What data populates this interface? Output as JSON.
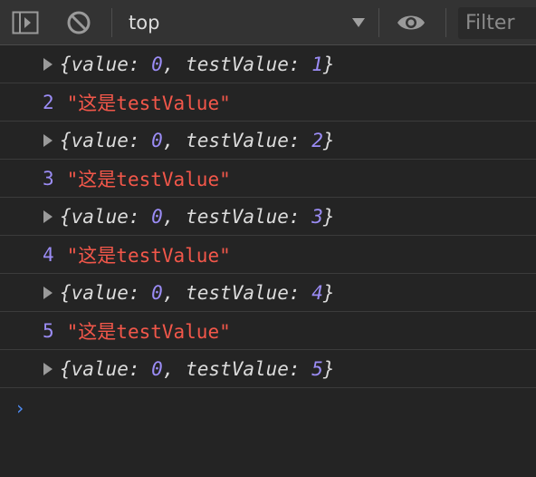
{
  "toolbar": {
    "context_label": "top",
    "filter_placeholder": "Filter",
    "icons": [
      "sidebar-toggle-icon",
      "clear-console-icon",
      "dropdown-triangle-icon",
      "eye-icon"
    ]
  },
  "console": {
    "rows": [
      {
        "brace_open": "{",
        "k1": "value",
        "v1": "0",
        "comma": ", ",
        "k2": "testValue",
        "v2": "1",
        "brace_close": "}"
      },
      {
        "num": "2",
        "str": "\"这是testValue\""
      },
      {
        "brace_open": "{",
        "k1": "value",
        "v1": "0",
        "comma": ", ",
        "k2": "testValue",
        "v2": "2",
        "brace_close": "}"
      },
      {
        "num": "3",
        "str": "\"这是testValue\""
      },
      {
        "brace_open": "{",
        "k1": "value",
        "v1": "0",
        "comma": ", ",
        "k2": "testValue",
        "v2": "3",
        "brace_close": "}"
      },
      {
        "num": "4",
        "str": "\"这是testValue\""
      },
      {
        "brace_open": "{",
        "k1": "value",
        "v1": "0",
        "comma": ", ",
        "k2": "testValue",
        "v2": "4",
        "brace_close": "}"
      },
      {
        "num": "5",
        "str": "\"这是testValue\""
      },
      {
        "brace_open": "{",
        "k1": "value",
        "v1": "0",
        "comma": ", ",
        "k2": "testValue",
        "v2": "5",
        "brace_close": "}"
      }
    ],
    "prompt": "›"
  },
  "colors": {
    "background": "#242424",
    "toolbar": "#333333",
    "number": "#9b8cf5",
    "string": "#f2574a",
    "prompt": "#4f8df6"
  }
}
